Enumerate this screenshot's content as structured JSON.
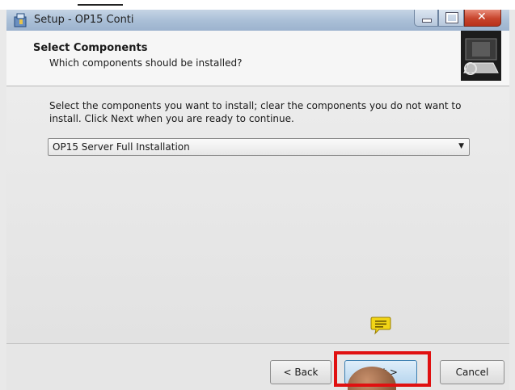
{
  "window": {
    "title": "Setup - OP15 Conti"
  },
  "header": {
    "title": "Select Components",
    "subtitle": "Which components should be installed?"
  },
  "content": {
    "description": "Select the components you want to install; clear the components you do not want to install. Click Next when you are ready to continue.",
    "components_dropdown": {
      "selected": "OP15 Server Full Installation"
    }
  },
  "footer": {
    "back_label": "< Back",
    "next_label": "Next >",
    "cancel_label": "Cancel"
  },
  "colors": {
    "highlight": "#e01010",
    "note_icon": "#f2d516"
  },
  "icons": [
    "setup-app-icon",
    "minimize-icon",
    "maximize-icon",
    "close-icon",
    "wizard-computer-icon",
    "note-comment-icon",
    "chevron-down-icon"
  ]
}
